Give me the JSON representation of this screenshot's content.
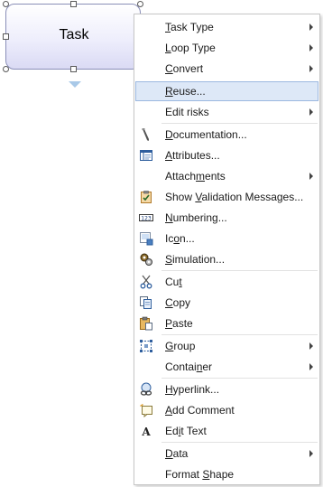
{
  "task": {
    "label": "Task"
  },
  "menu": {
    "items": [
      {
        "pre": "",
        "u": "T",
        "post": "ask Type"
      },
      {
        "pre": "",
        "u": "L",
        "post": "oop Type"
      },
      {
        "pre": "",
        "u": "C",
        "post": "onvert"
      },
      {
        "pre": "",
        "u": "R",
        "post": "euse..."
      },
      {
        "pre": "Edit risks",
        "u": "",
        "post": ""
      },
      {
        "pre": "",
        "u": "D",
        "post": "ocumentation..."
      },
      {
        "pre": "",
        "u": "A",
        "post": "ttributes..."
      },
      {
        "pre": "Attach",
        "u": "m",
        "post": "ents"
      },
      {
        "pre": "Show ",
        "u": "V",
        "post": "alidation Messages..."
      },
      {
        "pre": "",
        "u": "N",
        "post": "umbering..."
      },
      {
        "pre": "Ic",
        "u": "o",
        "post": "n..."
      },
      {
        "pre": "",
        "u": "S",
        "post": "imulation..."
      },
      {
        "pre": "Cu",
        "u": "t",
        "post": ""
      },
      {
        "pre": "",
        "u": "C",
        "post": "opy"
      },
      {
        "pre": "",
        "u": "P",
        "post": "aste"
      },
      {
        "pre": "",
        "u": "G",
        "post": "roup"
      },
      {
        "pre": "Contai",
        "u": "n",
        "post": "er"
      },
      {
        "pre": "",
        "u": "H",
        "post": "yperlink..."
      },
      {
        "pre": "",
        "u": "A",
        "post": "dd Comment"
      },
      {
        "pre": "Ed",
        "u": "i",
        "post": "t Text"
      },
      {
        "pre": "",
        "u": "D",
        "post": "ata"
      },
      {
        "pre": "Format ",
        "u": "S",
        "post": "hape"
      }
    ]
  },
  "icons": [
    "",
    "",
    "",
    "",
    "",
    "pencil-icon",
    "attributes-table-icon",
    "",
    "clipboard-check-icon",
    "numbering-icon",
    "icon-picture-icon",
    "simulation-gear-icon",
    "scissors-icon",
    "copy-icon",
    "paste-icon",
    "group-icon",
    "",
    "hyperlink-chain-icon",
    "add-comment-icon",
    "edit-text-icon",
    "",
    ""
  ],
  "colors": {
    "highlight": "#dde8f7",
    "highlight_border": "#9cb8e0",
    "task_border": "#8a8fb8",
    "task_fill": "#eeeefc"
  }
}
